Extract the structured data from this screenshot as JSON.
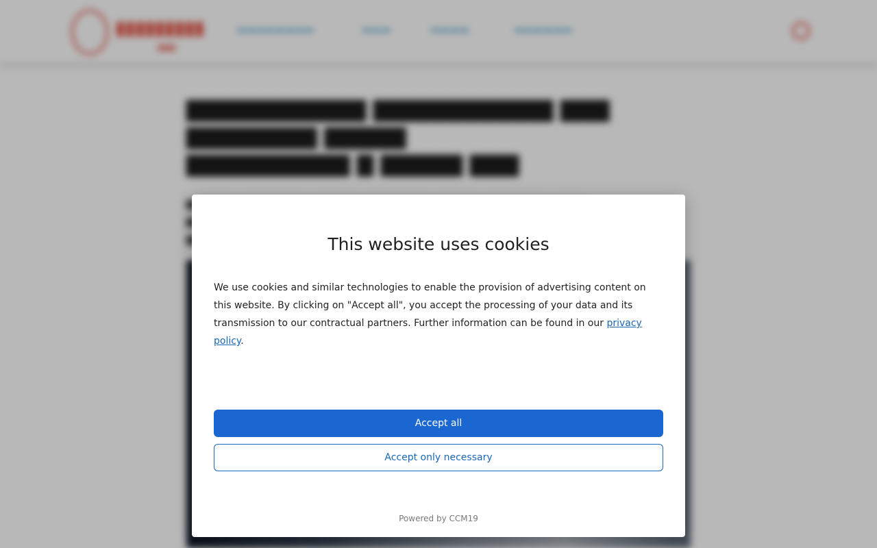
{
  "background_page": {
    "logo": {
      "icon": "logo-icon"
    },
    "nav_items": [],
    "search_icon": "search-icon",
    "colors": {
      "brand": "#e24a3b",
      "nav": "#6fb3d9"
    }
  },
  "consent": {
    "title": "This website uses cookies",
    "text_before_link": "We use cookies and similar technologies to enable the provision of advertising content on this website. By clicking on \"Accept all\", you accept the processing of your data and its transmission to our contractual partners. Further information can be found in our ",
    "privacy_link": "privacy policy",
    "text_after_link": ".",
    "accept_all_label": "Accept all",
    "accept_necessary_label": "Accept only necessary",
    "powered_by": "Powered by CCM19",
    "colors": {
      "primary": "#1a67d2",
      "link": "#1a67b6"
    }
  }
}
